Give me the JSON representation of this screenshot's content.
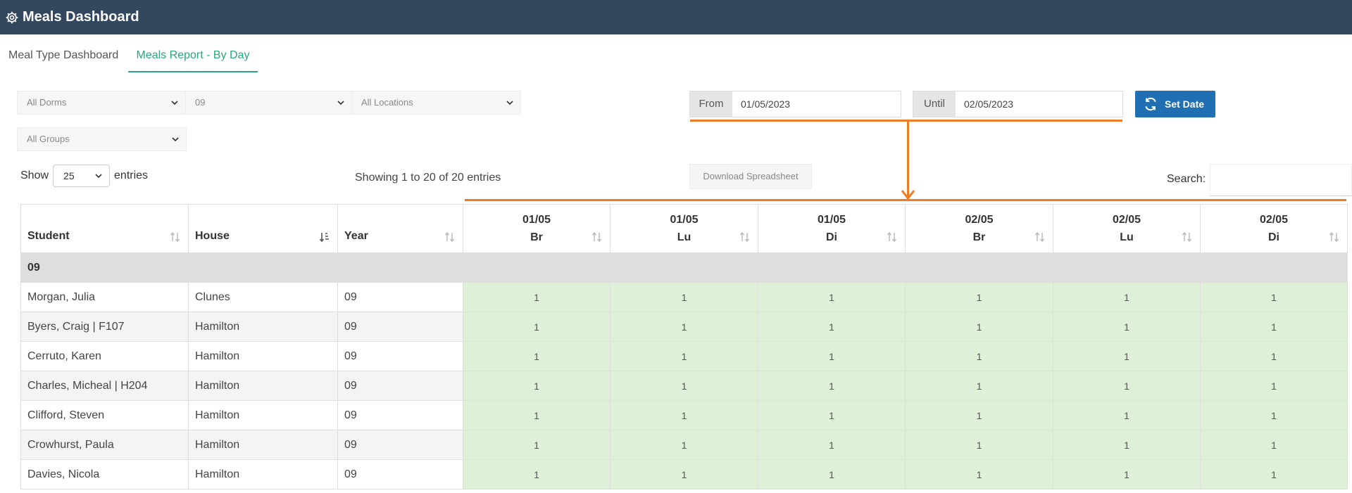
{
  "app": {
    "title": "Meals Dashboard"
  },
  "tabs": [
    {
      "label": "Meal Type Dashboard",
      "active": false
    },
    {
      "label": "Meals Report - By Day",
      "active": true
    }
  ],
  "filters": {
    "dorms": "All Dorms",
    "year": "09",
    "locations": "All Locations",
    "groups": "All Groups"
  },
  "date_range": {
    "from_label": "From",
    "from_value": "01/05/2023",
    "until_label": "Until",
    "until_value": "02/05/2023",
    "set_label": "Set Date"
  },
  "entries": {
    "show_label": "Show",
    "page_size": "25",
    "entries_label": "entries"
  },
  "info_text": "Showing 1 to 20 of 20 entries",
  "download_label": "Download Spreadsheet",
  "search_label": "Search:",
  "table": {
    "headers": [
      "Student",
      "House",
      "Year"
    ],
    "date_columns": [
      {
        "date": "01/05",
        "meal": "Br"
      },
      {
        "date": "01/05",
        "meal": "Lu"
      },
      {
        "date": "01/05",
        "meal": "Di"
      },
      {
        "date": "02/05",
        "meal": "Br"
      },
      {
        "date": "02/05",
        "meal": "Lu"
      },
      {
        "date": "02/05",
        "meal": "Di"
      }
    ],
    "group_label": "09",
    "rows": [
      {
        "student": "Morgan, Julia",
        "house": "Clunes",
        "year": "09",
        "values": [
          "1",
          "1",
          "1",
          "1",
          "1",
          "1"
        ]
      },
      {
        "student": "Byers, Craig | F107",
        "house": "Hamilton",
        "year": "09",
        "values": [
          "1",
          "1",
          "1",
          "1",
          "1",
          "1"
        ]
      },
      {
        "student": "Cerruto, Karen",
        "house": "Hamilton",
        "year": "09",
        "values": [
          "1",
          "1",
          "1",
          "1",
          "1",
          "1"
        ]
      },
      {
        "student": "Charles, Micheal | H204",
        "house": "Hamilton",
        "year": "09",
        "values": [
          "1",
          "1",
          "1",
          "1",
          "1",
          "1"
        ]
      },
      {
        "student": "Clifford, Steven",
        "house": "Hamilton",
        "year": "09",
        "values": [
          "1",
          "1",
          "1",
          "1",
          "1",
          "1"
        ]
      },
      {
        "student": "Crowhurst, Paula",
        "house": "Hamilton",
        "year": "09",
        "values": [
          "1",
          "1",
          "1",
          "1",
          "1",
          "1"
        ]
      },
      {
        "student": "Davies, Nicola",
        "house": "Hamilton",
        "year": "09",
        "values": [
          "1",
          "1",
          "1",
          "1",
          "1",
          "1"
        ]
      }
    ]
  },
  "colors": {
    "topbar": "#33475e",
    "accent_green": "#2aa67a",
    "button_blue": "#1f6fb2",
    "annotation_orange": "#ee7b27",
    "cell_green": "#dff0d8"
  }
}
